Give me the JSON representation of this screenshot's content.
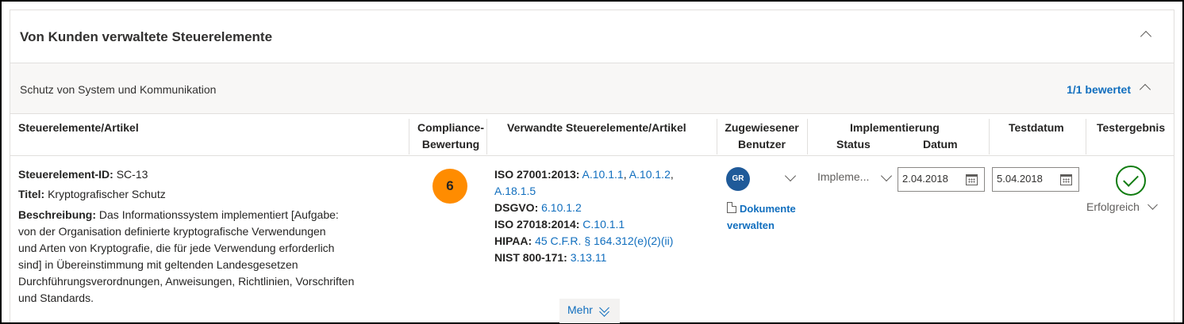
{
  "section": {
    "title": "Von Kunden verwaltete Steuerelemente"
  },
  "group": {
    "name": "Schutz von System und Kommunikation",
    "count": "1/1 bewertet"
  },
  "columns": {
    "control": "Steuerelemente/Artikel",
    "score_line1": "Compliance-",
    "score_line2": "Bewertung",
    "related": "Verwandte Steuerelemente/Artikel",
    "assigned_line1": "Zugewiesener",
    "assigned_line2": "Benutzer",
    "implementation": "Implementierung",
    "impl_status": "Status",
    "impl_date": "Datum",
    "test_date": "Testdatum",
    "test_result": "Testergebnis"
  },
  "row": {
    "id_label": "Steuerelement-ID:",
    "id_value": "SC-13",
    "title_label": "Titel:",
    "title_value": "Kryptografischer Schutz",
    "desc_label": "Beschreibung:",
    "desc_lines": [
      "Das Informationssystem implementiert [Aufgabe:",
      "von der Organisation definierte kryptografische Verwendungen",
      "und Arten von Kryptografie, die für jede Verwendung erforderlich",
      "sind] in Übereinstimmung mit geltenden Landesgesetzen",
      "Durchführungsverordnungen, Anweisungen, Richtlinien, Vorschriften",
      "und Standards."
    ],
    "score": "6",
    "related": {
      "iso27001_label": "ISO 27001:2013:",
      "iso27001_link1": "A.10.1.1",
      "iso27001_link2": "A.10.1.2",
      "iso27001_link3": "A.18.1.5",
      "dsgvo_label": "DSGVO:",
      "dsgvo_link": "6.10.1.2",
      "iso27018_label": "ISO 27018:2014:",
      "iso27018_link": "C.10.1.1",
      "hipaa_label": "HIPAA:",
      "hipaa_link": "45 C.F.R. § 164.312(e)(2)(ii)",
      "nist_label": "NIST 800-171:",
      "nist_link": "3.13.11"
    },
    "more_label": "Mehr",
    "assigned_initials": "GR",
    "manage_docs_line1": "Dokumente",
    "manage_docs_line2": "verwalten",
    "impl_status_value": "Impleme...",
    "impl_date_value": "2.04.2018",
    "test_date_value": "5.04.2018",
    "test_result_value": "Erfolgreich"
  },
  "colors": {
    "accent": "#106ebe",
    "score": "#ff8c00",
    "success": "#107c10",
    "avatar": "#1f5a99"
  },
  "icons": [
    "chevron-up-icon",
    "chevron-down-icon",
    "calendar-icon",
    "check-circle-icon",
    "document-icon"
  ]
}
